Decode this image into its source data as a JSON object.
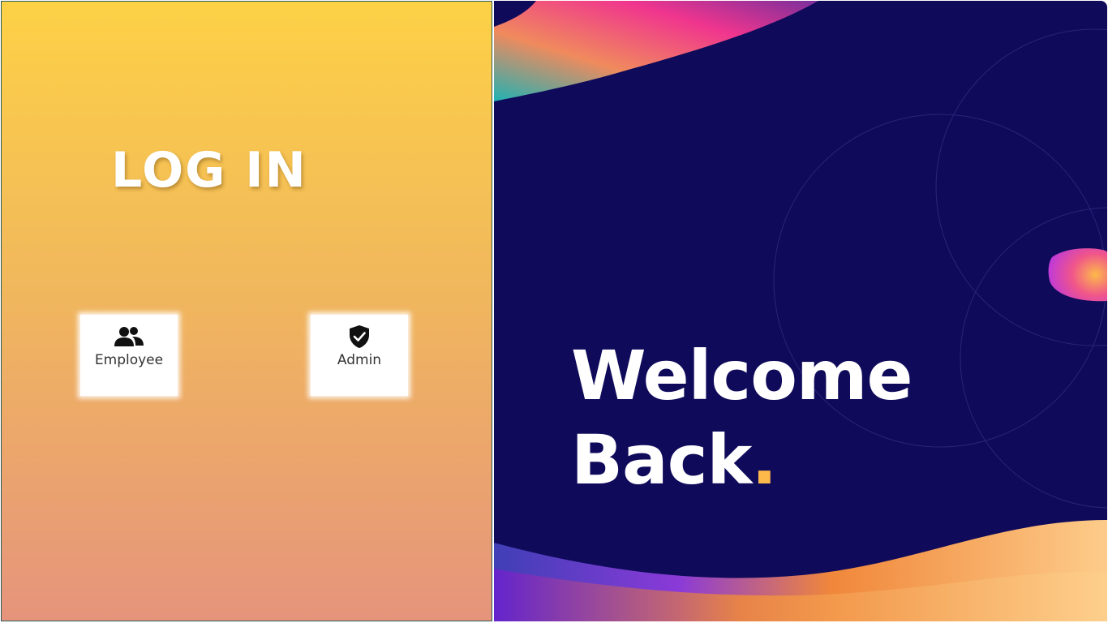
{
  "login": {
    "title": "LOG IN",
    "roles": [
      {
        "label": "Employee",
        "icon": "users-icon"
      },
      {
        "label": "Admin",
        "icon": "shield-check-icon"
      }
    ]
  },
  "hero": {
    "line1": "Welcome",
    "line2": "Back",
    "dot": "."
  },
  "colors": {
    "left_gradient_top": "#fdd146",
    "left_gradient_bottom": "#e6947c",
    "right_background": "#0f0a5a",
    "accent_dot": "#fdb94a"
  }
}
